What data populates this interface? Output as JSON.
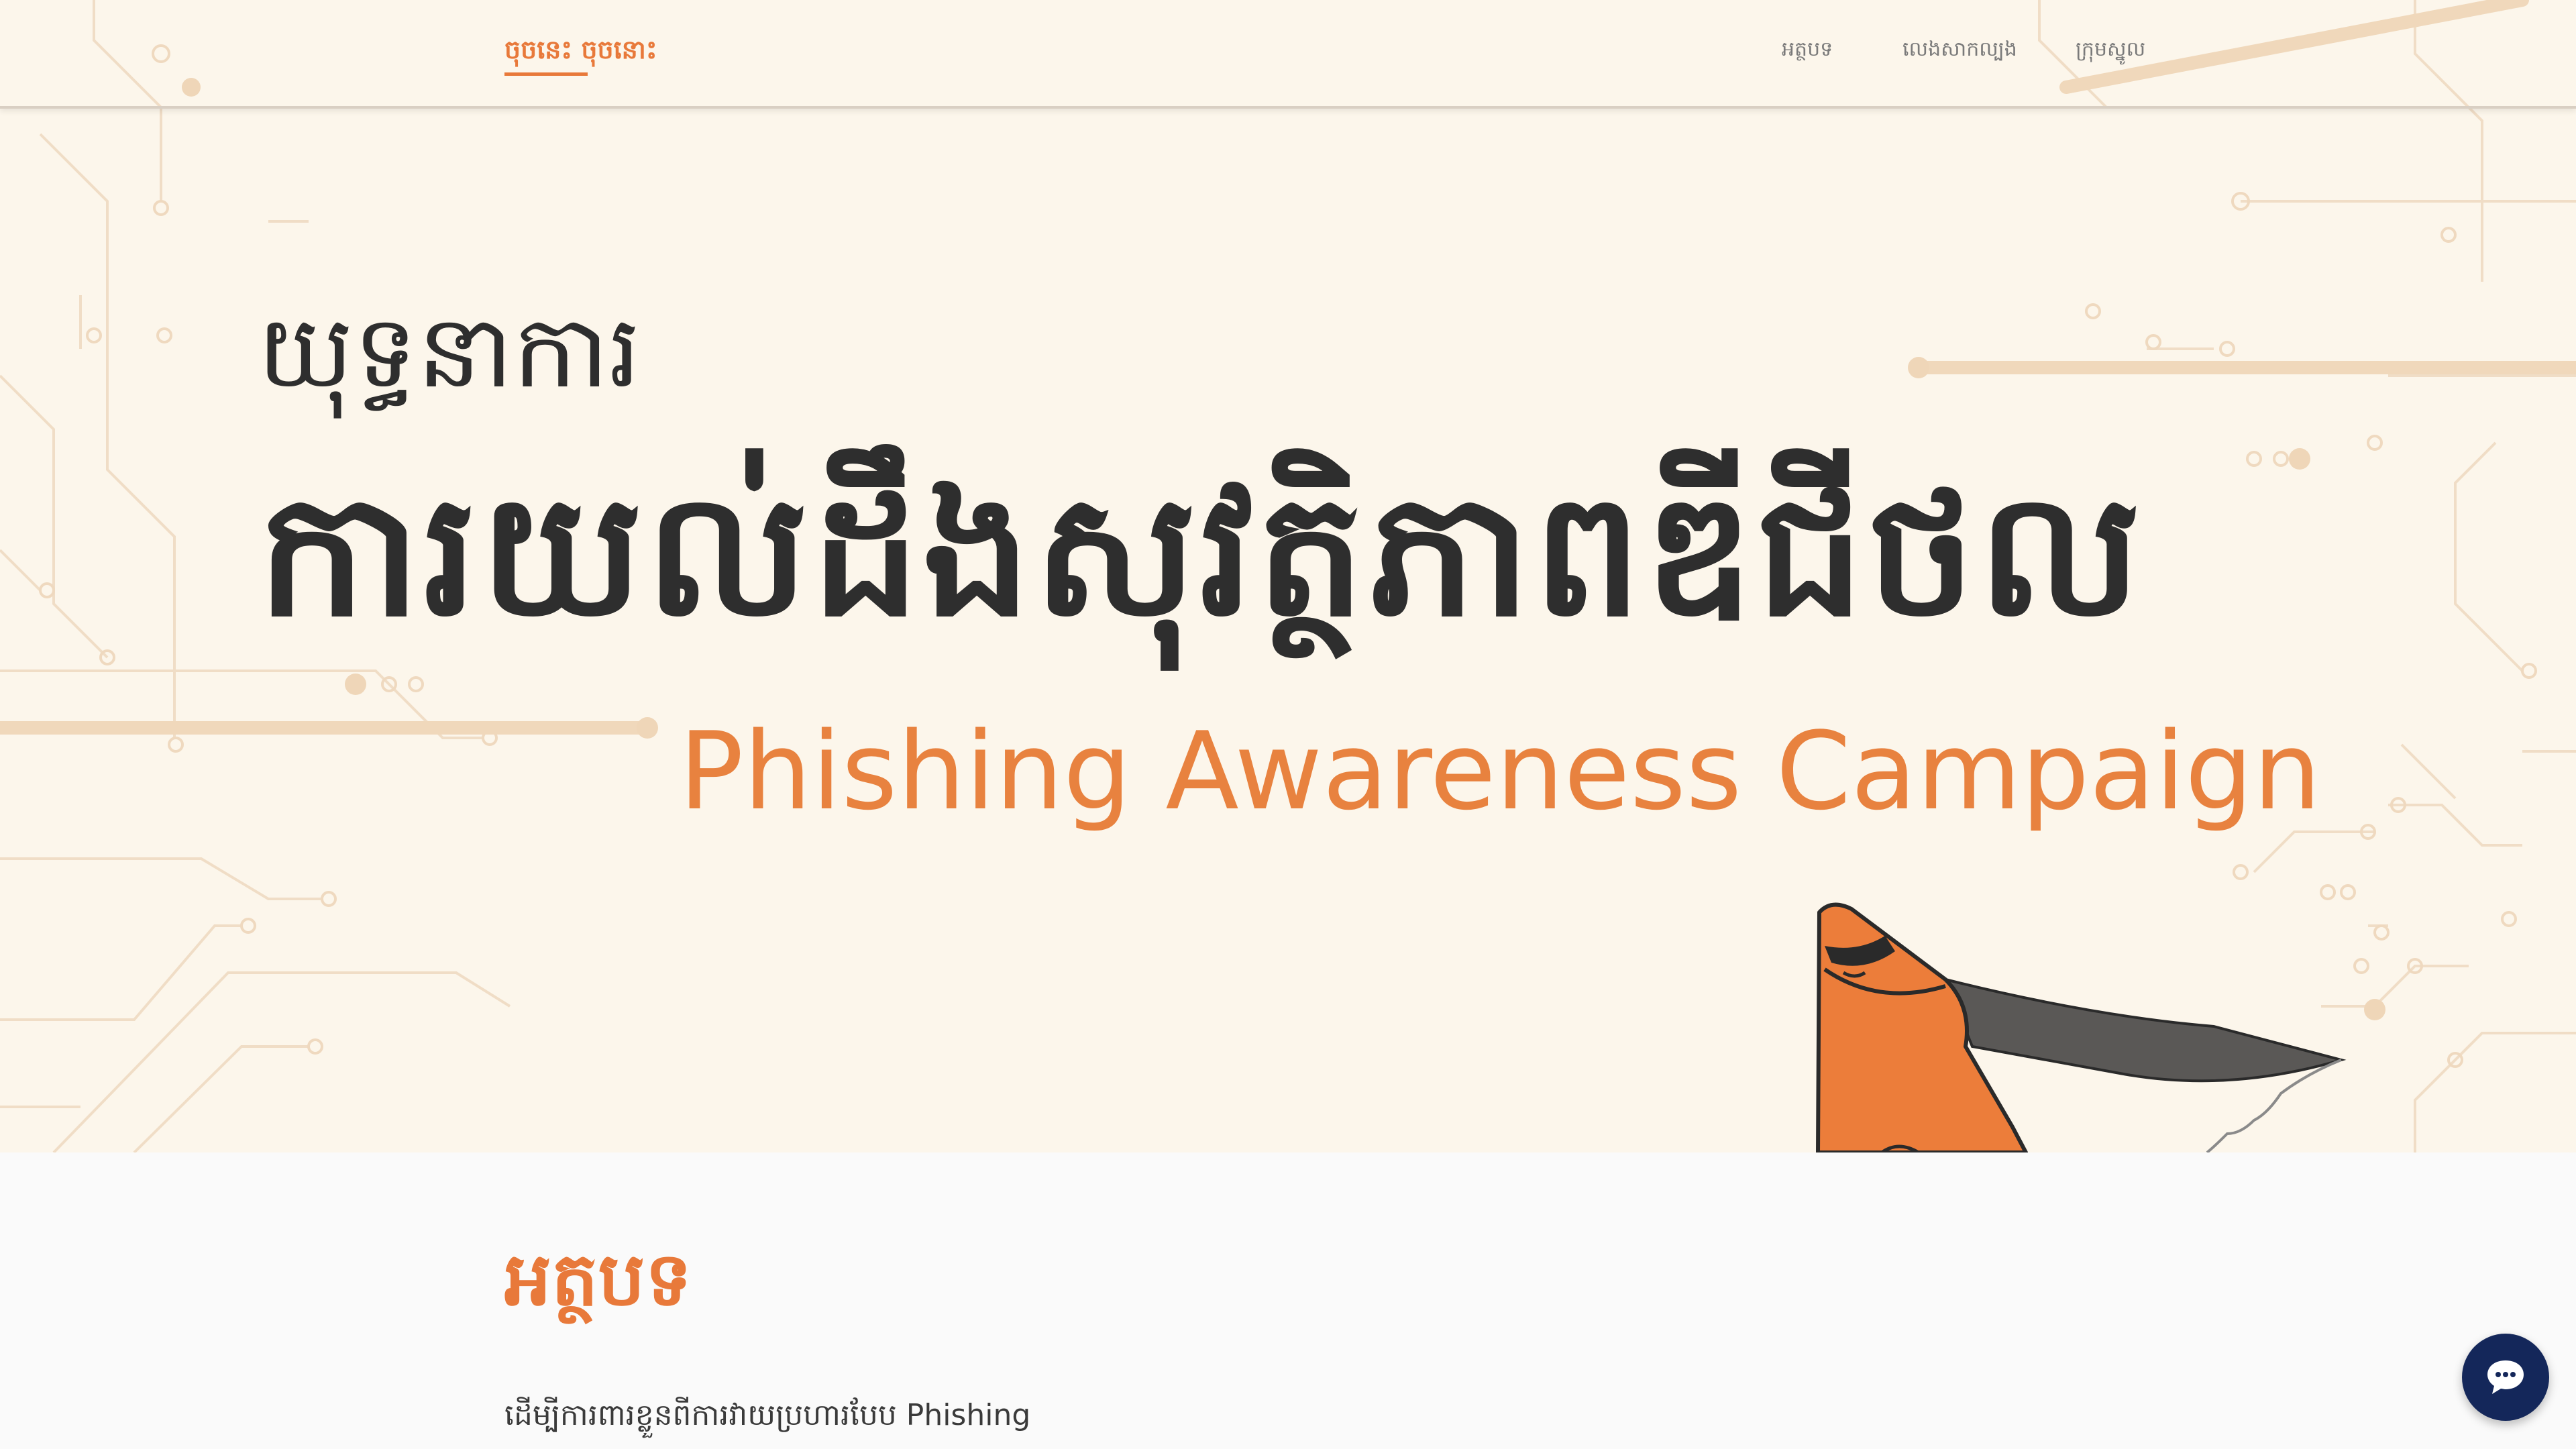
{
  "nav": {
    "brand": "ចុចនេះ ចុចនោះ",
    "links": [
      "អត្ថបទ",
      "លេងសាកល្បង",
      "ក្រុមស្នូល"
    ]
  },
  "hero": {
    "small_title": "យុទ្ធនាការ",
    "big_title": "ការយល់ដឹងសុវត្ថិភាពឌីជីថល",
    "english_title": "Phishing Awareness Campaign"
  },
  "section": {
    "title": "អត្ថបទ",
    "text": "ដើម្បីការពារខ្លួនពីការវាយប្រហារបែប Phishing"
  },
  "icons": {
    "chat": "chat-bubble-icon",
    "mascot": "hooded-triangle-mascot"
  },
  "colors": {
    "accent": "#e8793a",
    "hero_bg": "#fcf6eb",
    "chat_button": "#14275a",
    "text_dark": "#2e2e2e"
  }
}
